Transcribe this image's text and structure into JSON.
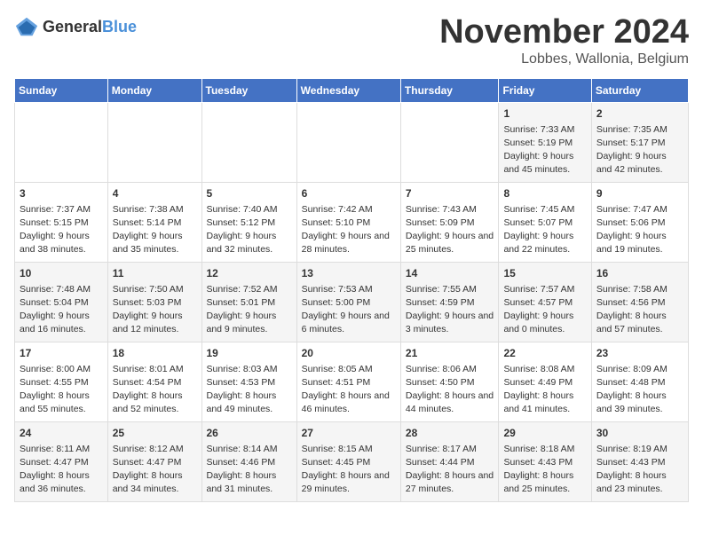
{
  "logo": {
    "general": "General",
    "blue": "Blue"
  },
  "title": {
    "month": "November 2024",
    "location": "Lobbes, Wallonia, Belgium"
  },
  "weekdays": [
    "Sunday",
    "Monday",
    "Tuesday",
    "Wednesday",
    "Thursday",
    "Friday",
    "Saturday"
  ],
  "weeks": [
    [
      {
        "day": "",
        "info": ""
      },
      {
        "day": "",
        "info": ""
      },
      {
        "day": "",
        "info": ""
      },
      {
        "day": "",
        "info": ""
      },
      {
        "day": "",
        "info": ""
      },
      {
        "day": "1",
        "info": "Sunrise: 7:33 AM\nSunset: 5:19 PM\nDaylight: 9 hours and 45 minutes."
      },
      {
        "day": "2",
        "info": "Sunrise: 7:35 AM\nSunset: 5:17 PM\nDaylight: 9 hours and 42 minutes."
      }
    ],
    [
      {
        "day": "3",
        "info": "Sunrise: 7:37 AM\nSunset: 5:15 PM\nDaylight: 9 hours and 38 minutes."
      },
      {
        "day": "4",
        "info": "Sunrise: 7:38 AM\nSunset: 5:14 PM\nDaylight: 9 hours and 35 minutes."
      },
      {
        "day": "5",
        "info": "Sunrise: 7:40 AM\nSunset: 5:12 PM\nDaylight: 9 hours and 32 minutes."
      },
      {
        "day": "6",
        "info": "Sunrise: 7:42 AM\nSunset: 5:10 PM\nDaylight: 9 hours and 28 minutes."
      },
      {
        "day": "7",
        "info": "Sunrise: 7:43 AM\nSunset: 5:09 PM\nDaylight: 9 hours and 25 minutes."
      },
      {
        "day": "8",
        "info": "Sunrise: 7:45 AM\nSunset: 5:07 PM\nDaylight: 9 hours and 22 minutes."
      },
      {
        "day": "9",
        "info": "Sunrise: 7:47 AM\nSunset: 5:06 PM\nDaylight: 9 hours and 19 minutes."
      }
    ],
    [
      {
        "day": "10",
        "info": "Sunrise: 7:48 AM\nSunset: 5:04 PM\nDaylight: 9 hours and 16 minutes."
      },
      {
        "day": "11",
        "info": "Sunrise: 7:50 AM\nSunset: 5:03 PM\nDaylight: 9 hours and 12 minutes."
      },
      {
        "day": "12",
        "info": "Sunrise: 7:52 AM\nSunset: 5:01 PM\nDaylight: 9 hours and 9 minutes."
      },
      {
        "day": "13",
        "info": "Sunrise: 7:53 AM\nSunset: 5:00 PM\nDaylight: 9 hours and 6 minutes."
      },
      {
        "day": "14",
        "info": "Sunrise: 7:55 AM\nSunset: 4:59 PM\nDaylight: 9 hours and 3 minutes."
      },
      {
        "day": "15",
        "info": "Sunrise: 7:57 AM\nSunset: 4:57 PM\nDaylight: 9 hours and 0 minutes."
      },
      {
        "day": "16",
        "info": "Sunrise: 7:58 AM\nSunset: 4:56 PM\nDaylight: 8 hours and 57 minutes."
      }
    ],
    [
      {
        "day": "17",
        "info": "Sunrise: 8:00 AM\nSunset: 4:55 PM\nDaylight: 8 hours and 55 minutes."
      },
      {
        "day": "18",
        "info": "Sunrise: 8:01 AM\nSunset: 4:54 PM\nDaylight: 8 hours and 52 minutes."
      },
      {
        "day": "19",
        "info": "Sunrise: 8:03 AM\nSunset: 4:53 PM\nDaylight: 8 hours and 49 minutes."
      },
      {
        "day": "20",
        "info": "Sunrise: 8:05 AM\nSunset: 4:51 PM\nDaylight: 8 hours and 46 minutes."
      },
      {
        "day": "21",
        "info": "Sunrise: 8:06 AM\nSunset: 4:50 PM\nDaylight: 8 hours and 44 minutes."
      },
      {
        "day": "22",
        "info": "Sunrise: 8:08 AM\nSunset: 4:49 PM\nDaylight: 8 hours and 41 minutes."
      },
      {
        "day": "23",
        "info": "Sunrise: 8:09 AM\nSunset: 4:48 PM\nDaylight: 8 hours and 39 minutes."
      }
    ],
    [
      {
        "day": "24",
        "info": "Sunrise: 8:11 AM\nSunset: 4:47 PM\nDaylight: 8 hours and 36 minutes."
      },
      {
        "day": "25",
        "info": "Sunrise: 8:12 AM\nSunset: 4:47 PM\nDaylight: 8 hours and 34 minutes."
      },
      {
        "day": "26",
        "info": "Sunrise: 8:14 AM\nSunset: 4:46 PM\nDaylight: 8 hours and 31 minutes."
      },
      {
        "day": "27",
        "info": "Sunrise: 8:15 AM\nSunset: 4:45 PM\nDaylight: 8 hours and 29 minutes."
      },
      {
        "day": "28",
        "info": "Sunrise: 8:17 AM\nSunset: 4:44 PM\nDaylight: 8 hours and 27 minutes."
      },
      {
        "day": "29",
        "info": "Sunrise: 8:18 AM\nSunset: 4:43 PM\nDaylight: 8 hours and 25 minutes."
      },
      {
        "day": "30",
        "info": "Sunrise: 8:19 AM\nSunset: 4:43 PM\nDaylight: 8 hours and 23 minutes."
      }
    ]
  ]
}
